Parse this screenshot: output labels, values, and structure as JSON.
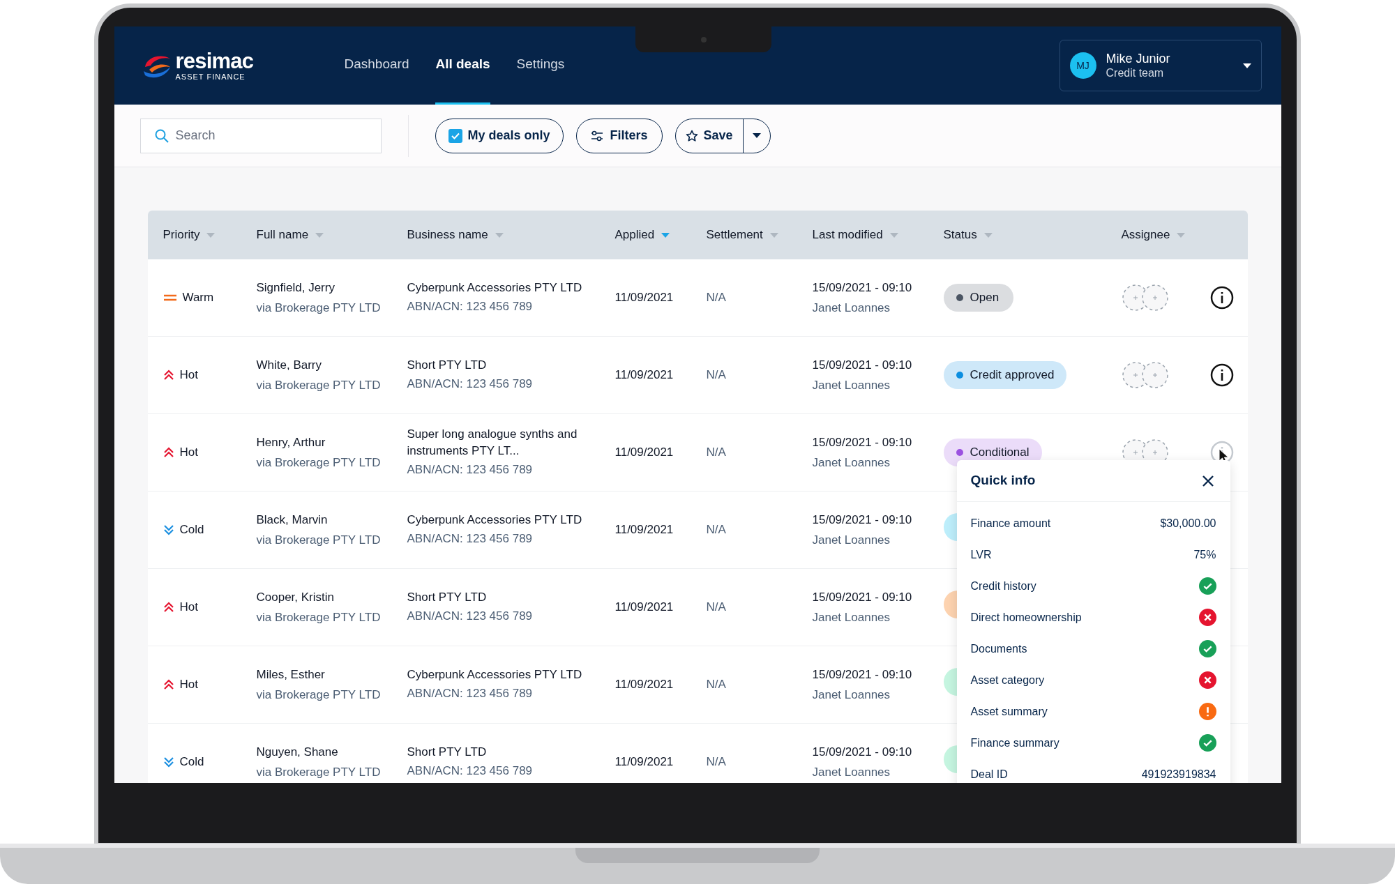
{
  "brand": {
    "name": "resimac",
    "tagline": "ASSET FINANCE"
  },
  "nav": [
    {
      "label": "Dashboard",
      "selected": false
    },
    {
      "label": "All deals",
      "selected": true
    },
    {
      "label": "Settings",
      "selected": false
    }
  ],
  "user": {
    "initials": "MJ",
    "name": "Mike Junior",
    "role": "Credit team"
  },
  "toolbar": {
    "search": {
      "placeholder": "Search"
    },
    "my_deals_only": {
      "label": "My deals only",
      "checked": true
    },
    "filters": "Filters",
    "save": "Save"
  },
  "table": {
    "columns": [
      {
        "label": "Priority",
        "sorted": false
      },
      {
        "label": "Full name",
        "sorted": false
      },
      {
        "label": "Business name",
        "sorted": false
      },
      {
        "label": "Applied",
        "sorted": true
      },
      {
        "label": "Settlement",
        "sorted": false
      },
      {
        "label": "Last modified",
        "sorted": false
      },
      {
        "label": "Status",
        "sorted": false
      },
      {
        "label": "Assignee",
        "sorted": false
      }
    ],
    "rows": [
      {
        "priority": {
          "kind": "warm",
          "label": "Warm"
        },
        "name": "Signfield, Jerry",
        "via": "via Brokerage PTY LTD",
        "business": "Cyberpunk Accessories PTY LTD",
        "abn": "ABN/ACN: 123 456 789",
        "applied": "11/09/2021",
        "settlement": "N/A",
        "modified": "15/09/2021 - 09:10",
        "modified_by": "Janet Loannes",
        "status": {
          "label": "Open",
          "color": "#4b5563"
        },
        "info": {
          "dimmed": false
        }
      },
      {
        "priority": {
          "kind": "hot",
          "label": "Hot"
        },
        "name": "White, Barry",
        "via": "via Brokerage PTY LTD",
        "business": "Short PTY LTD",
        "abn": "ABN/ACN: 123 456 789",
        "applied": "11/09/2021",
        "settlement": "N/A",
        "modified": "15/09/2021 - 09:10",
        "modified_by": "Janet Loannes",
        "status": {
          "label": "Credit approved",
          "color": "#0b8ee0"
        },
        "info": {
          "dimmed": false
        }
      },
      {
        "priority": {
          "kind": "hot",
          "label": "Hot"
        },
        "name": "Henry, Arthur",
        "via": "via Brokerage PTY LTD",
        "business": "Super long analogue synths and instruments PTY LT...",
        "abn": "ABN/ACN: 123 456 789",
        "applied": "11/09/2021",
        "settlement": "N/A",
        "modified": "15/09/2021 - 09:10",
        "modified_by": "Janet Loannes",
        "status": {
          "label": "Conditional",
          "color": "#9b51e0"
        },
        "info": {
          "dimmed": true
        }
      },
      {
        "priority": {
          "kind": "cold",
          "label": "Cold"
        },
        "name": "Black, Marvin",
        "via": "via Brokerage PTY LTD",
        "business": "Cyberpunk Accessories PTY LTD",
        "abn": "ABN/ACN: 123 456 789",
        "applied": "11/09/2021",
        "settlement": "N/A",
        "modified": "15/09/2021 - 09:10",
        "modified_by": "Janet Loannes",
        "status": {
          "color": "#bdeefb"
        }
      },
      {
        "priority": {
          "kind": "hot",
          "label": "Hot"
        },
        "name": "Cooper, Kristin",
        "via": "via Brokerage PTY LTD",
        "business": "Short PTY LTD",
        "abn": "ABN/ACN: 123 456 789",
        "applied": "11/09/2021",
        "settlement": "N/A",
        "modified": "15/09/2021 - 09:10",
        "modified_by": "Janet Loannes",
        "status": {
          "color": "#fdd3b0"
        }
      },
      {
        "priority": {
          "kind": "hot",
          "label": "Hot"
        },
        "name": "Miles, Esther",
        "via": "via Brokerage PTY LTD",
        "business": "Cyberpunk Accessories PTY LTD",
        "abn": "ABN/ACN: 123 456 789",
        "applied": "11/09/2021",
        "settlement": "N/A",
        "modified": "15/09/2021 - 09:10",
        "modified_by": "Janet Loannes",
        "status": {
          "color": "#c5f5e0"
        }
      },
      {
        "priority": {
          "kind": "cold",
          "label": "Cold"
        },
        "name": "Nguyen, Shane",
        "via": "via Brokerage PTY LTD",
        "business": "Short PTY LTD",
        "abn": "ABN/ACN: 123 456 789",
        "applied": "11/09/2021",
        "settlement": "N/A",
        "modified": "15/09/2021 - 09:10",
        "modified_by": "Janet Loannes",
        "status": {
          "color": "#c5f5e0"
        }
      }
    ]
  },
  "quick_info": {
    "title": "Quick info",
    "items": [
      {
        "kind": "value",
        "label": "Finance amount",
        "value": "$30,000.00"
      },
      {
        "kind": "value",
        "label": "LVR",
        "value": "75%"
      },
      {
        "kind": "pass",
        "label": "Credit history"
      },
      {
        "kind": "fail",
        "label": "Direct homeownership"
      },
      {
        "kind": "pass",
        "label": "Documents"
      },
      {
        "kind": "fail",
        "label": "Asset category"
      },
      {
        "kind": "warning",
        "label": "Asset summary"
      },
      {
        "kind": "pass",
        "label": "Finance summary"
      },
      {
        "kind": "value",
        "label": "Deal ID",
        "value": "491923919834"
      }
    ]
  }
}
